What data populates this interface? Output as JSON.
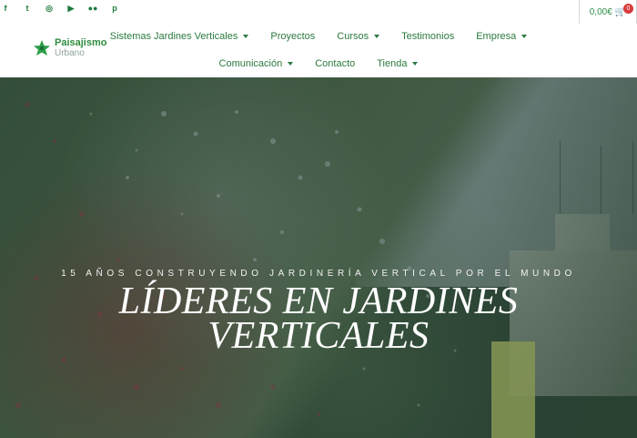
{
  "social": {
    "facebook": "f",
    "twitter": "t",
    "instagram": "◎",
    "youtube": "▶",
    "flickr": "●●",
    "pinterest": "p"
  },
  "cart": {
    "amount": "0,00€",
    "icon": "cart-icon",
    "badge": "0"
  },
  "logo": {
    "top": "Paisajismo",
    "bottom": "Urbano"
  },
  "nav": {
    "row1": [
      "Sistemas Jardines Verticales",
      "Proyectos",
      "Cursos",
      "Testimonios",
      "Empresa"
    ],
    "row2": [
      "Comunicación",
      "Contacto",
      "Tienda"
    ]
  },
  "hero": {
    "subtitle": "15 AÑOS CONSTRUYENDO JARDINERÍA VERTICAL POR EL MUNDO",
    "title_line1": "LÍDERES EN JARDINES",
    "title_line2": "VERTICALES"
  },
  "colors": {
    "brand_green": "#2b7a3f",
    "badge_red": "#d83b3b"
  }
}
